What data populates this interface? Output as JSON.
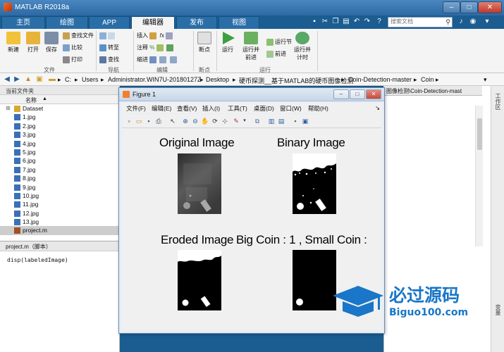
{
  "window": {
    "title": "MATLAB R2018a",
    "min_glyph": "–",
    "max_glyph": "□",
    "close_glyph": "✕"
  },
  "tabs": [
    {
      "label": "主页"
    },
    {
      "label": "绘图"
    },
    {
      "label": "APP"
    },
    {
      "label": "编辑器",
      "active": true
    },
    {
      "label": "发布"
    },
    {
      "label": "视图"
    }
  ],
  "search": {
    "placeholder": "搜索文档"
  },
  "ribbon": {
    "new_label": "新建",
    "open_label": "打开",
    "save_label": "保存",
    "find_files": "查找文件",
    "compare": "比较",
    "print": "打印",
    "goto": "转至",
    "find": "查找",
    "insert": "插入",
    "comment": "注释",
    "indent": "缩进",
    "breakpoints": "断点",
    "run": "运行",
    "run_advance": "运行并前进",
    "run_section": "运行节",
    "advance": "前进",
    "run_time": "运行并计时",
    "groups": {
      "file": "文件",
      "nav": "导航",
      "edit": "编辑",
      "bp": "断点",
      "run": "运行"
    }
  },
  "path": [
    "C:",
    "Users",
    "Administrator.WIN7U-20180127Z",
    "Desktop",
    "硬币探测__基于MATLAB的硬币图像检测",
    "Coin-Detection-master",
    "Coin"
  ],
  "current_folder": {
    "header": "当前文件夹",
    "column": "名称",
    "sort_glyph": "▲",
    "files": [
      {
        "name": "Dataset",
        "type": "folder"
      },
      {
        "name": "1.jpg",
        "type": "img"
      },
      {
        "name": "2.jpg",
        "type": "img"
      },
      {
        "name": "3.jpg",
        "type": "img"
      },
      {
        "name": "4.jpg",
        "type": "img"
      },
      {
        "name": "5.jpg",
        "type": "img"
      },
      {
        "name": "6.jpg",
        "type": "img"
      },
      {
        "name": "7.jpg",
        "type": "img"
      },
      {
        "name": "8.jpg",
        "type": "img"
      },
      {
        "name": "9.jpg",
        "type": "img"
      },
      {
        "name": "10.jpg",
        "type": "img"
      },
      {
        "name": "11.jpg",
        "type": "img"
      },
      {
        "name": "12.jpg",
        "type": "img"
      },
      {
        "name": "13.jpg",
        "type": "img"
      },
      {
        "name": "project.m",
        "type": "m",
        "selected": true
      }
    ]
  },
  "details": {
    "header": "project.m（脚本）",
    "code": "disp(labeledImage)"
  },
  "editor_tab": "图像检测\\Coin-Detection-mast",
  "side_tabs": {
    "workspace": "工作区",
    "vars": "变量"
  },
  "figure": {
    "title": "Figure 1",
    "menu": [
      "文件(F)",
      "编辑(E)",
      "查看(V)",
      "插入(I)",
      "工具(T)",
      "桌面(D)",
      "窗口(W)",
      "帮助(H)"
    ],
    "axes": [
      {
        "title": "Original Image"
      },
      {
        "title": "Binary Image"
      },
      {
        "title": "Eroded Image"
      },
      {
        "title": "Big Coin  : 1 , Small Coin :"
      }
    ]
  },
  "watermark": {
    "brand": "必过源码",
    "url": "Biguo100.com"
  },
  "colors": {
    "accent": "#1b5d91",
    "figure_bg": "#f0f0f0"
  }
}
